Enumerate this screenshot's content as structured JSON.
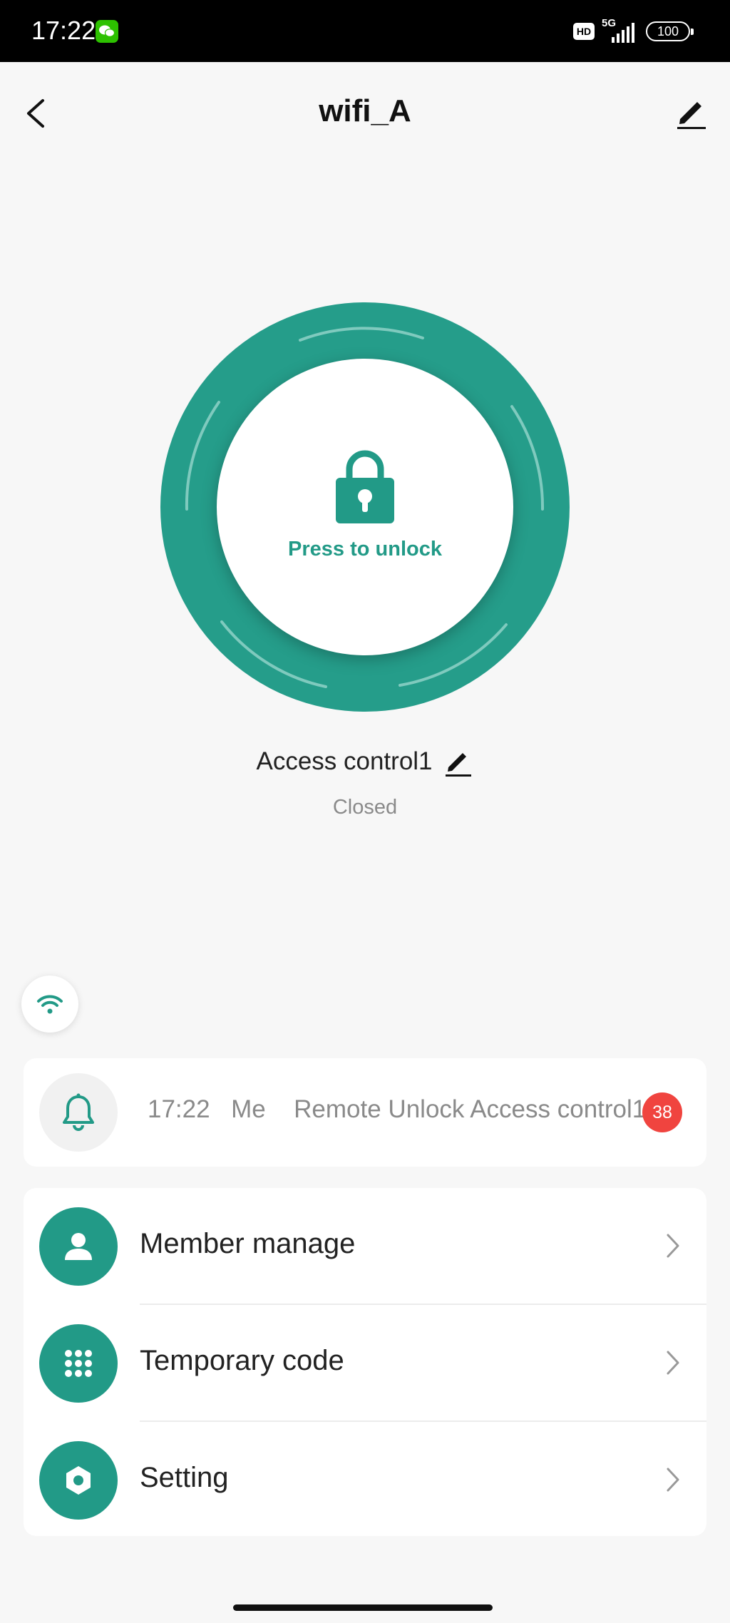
{
  "status_bar": {
    "time": "17:22",
    "network": "5G",
    "hd": "HD",
    "battery": "100"
  },
  "header": {
    "title": "wifi_A"
  },
  "lock": {
    "button_label": "Press to unlock"
  },
  "device": {
    "name": "Access control1",
    "status": "Closed"
  },
  "notification": {
    "time": "17:22",
    "user": "Me",
    "message": "Remote Unlock Access control1",
    "badge_count": "38"
  },
  "menu": {
    "items": [
      {
        "label": "Member manage",
        "icon": "person-icon"
      },
      {
        "label": "Temporary code",
        "icon": "keypad-icon"
      },
      {
        "label": "Setting",
        "icon": "gear-icon"
      }
    ]
  },
  "colors": {
    "accent": "#229a87",
    "badge": "#f0443f",
    "background": "#f7f7f7"
  }
}
